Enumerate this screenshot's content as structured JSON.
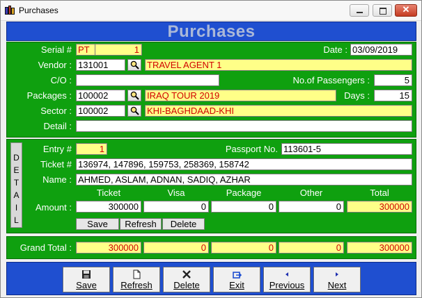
{
  "window": {
    "title": "Purchases"
  },
  "header": {
    "title": "Purchases"
  },
  "form": {
    "serial_label": "Serial #",
    "serial_prefix": "PT",
    "serial_no": "1",
    "date_label": "Date :",
    "date_value": "03/09/2019",
    "vendor_label": "Vendor :",
    "vendor_code": "131001",
    "vendor_name": "TRAVEL AGENT 1",
    "co_label": "C/O :",
    "co_value": "",
    "passengers_label": "No.of Passengers :",
    "passengers_value": "5",
    "packages_label": "Packages :",
    "package_code": "100002",
    "package_name": "IRAQ TOUR 2019",
    "days_label": "Days :",
    "days_value": "15",
    "sector_label": "Sector :",
    "sector_code": "100002",
    "sector_name": "KHI-BAGHDAAD-KHI",
    "detail_label": "Detail :",
    "detail_value": ""
  },
  "detail": {
    "tab_letters": [
      "D",
      "E",
      "T",
      "A",
      "I",
      "L"
    ],
    "entry_label": "Entry #",
    "entry_value": "1",
    "passport_label": "Passport No.",
    "passport_value": "113601-5",
    "ticket_label": "Ticket #",
    "ticket_value": "136974, 147896, 159753, 258369, 158742",
    "name_label": "Name :",
    "name_value": "AHMED, ASLAM, ADNAN, SADIQ, AZHAR",
    "col_ticket": "Ticket",
    "col_visa": "Visa",
    "col_package": "Package",
    "col_other": "Other",
    "col_total": "Total",
    "amount_label": "Amount :",
    "amount_ticket": "300000",
    "amount_visa": "0",
    "amount_package": "0",
    "amount_other": "0",
    "amount_total": "300000",
    "save_label": "Save",
    "refresh_label": "Refresh",
    "delete_label": "Delete"
  },
  "grand_total": {
    "label": "Grand Total :",
    "ticket": "300000",
    "visa": "0",
    "package": "0",
    "other": "0",
    "total": "300000"
  },
  "toolbar": {
    "save": "Save",
    "refresh": "Refresh",
    "delete": "Delete",
    "exit": "Exit",
    "previous": "Previous",
    "next": "Next"
  },
  "colors": {
    "panel_green": "#0fa00f",
    "header_blue": "#1f4fd0",
    "field_yellow": "#ffff88",
    "highlight_red": "#d10000"
  }
}
